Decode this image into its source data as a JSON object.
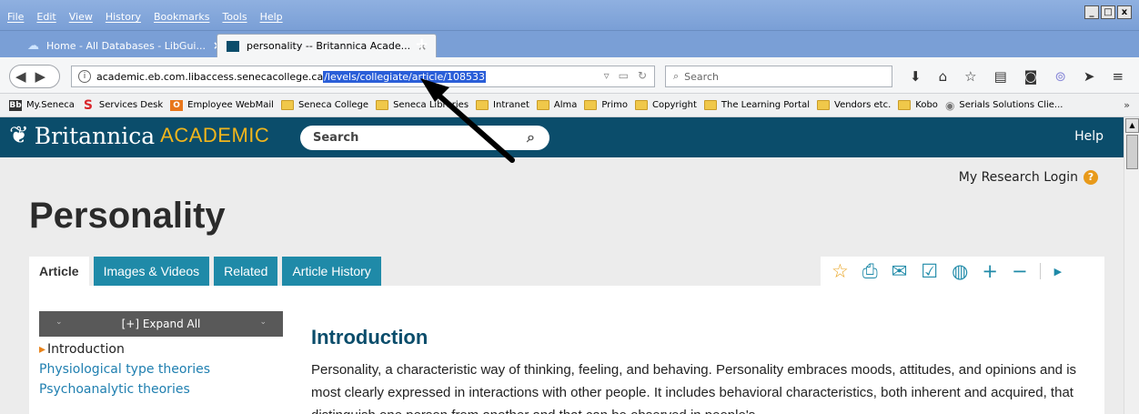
{
  "menu": [
    "File",
    "Edit",
    "View",
    "History",
    "Bookmarks",
    "Tools",
    "Help"
  ],
  "window_buttons": [
    "_",
    "□",
    "x"
  ],
  "tabs": [
    {
      "title": "Home - All Databases - LibGui...",
      "close": "×"
    },
    {
      "title": "personality -- Britannica Acade...",
      "close": "×"
    }
  ],
  "new_tab": "+",
  "url": {
    "host": "academic.eb.com.libaccess.senecacollege.ca",
    "path": "/levels/collegiate/article/108533"
  },
  "browser_search": {
    "placeholder": "Search"
  },
  "bookmarks": [
    {
      "label": "My.Seneca",
      "icon": "Bb"
    },
    {
      "label": "Services Desk",
      "icon": "S"
    },
    {
      "label": "Employee WebMail",
      "icon": "O"
    },
    {
      "label": "Seneca College",
      "icon": "folder"
    },
    {
      "label": "Seneca Libraries",
      "icon": "folder"
    },
    {
      "label": "Intranet",
      "icon": "folder"
    },
    {
      "label": "Alma",
      "icon": "folder"
    },
    {
      "label": "Primo",
      "icon": "folder"
    },
    {
      "label": "Copyright",
      "icon": "folder"
    },
    {
      "label": "The Learning Portal",
      "icon": "folder"
    },
    {
      "label": "Vendors etc.",
      "icon": "folder"
    },
    {
      "label": "Kobo",
      "icon": "folder"
    },
    {
      "label": "Serials Solutions Clie...",
      "icon": "globe"
    }
  ],
  "bookmarks_more": "»",
  "site": {
    "brand": "Britannica",
    "brand_sub": "ACADEMIC",
    "search_placeholder": "Search",
    "help": "Help",
    "login": "My Research Login",
    "login_icon": "?"
  },
  "article": {
    "title": "Personality",
    "tabs": [
      "Article",
      "Images & Videos",
      "Related",
      "Article History"
    ],
    "expand_all": "[+] Expand All",
    "toc": [
      "Introduction",
      "Physiological type theories",
      "Psychoanalytic theories"
    ],
    "heading": "Introduction",
    "text": "Personality,  a characteristic way of thinking, feeling, and behaving. Personality embraces moods, attitudes, and opinions and is most clearly expressed in interactions with other people. It includes behavioral characteristics, both inherent and acquired, that distinguish one person from another and that can be observed in people's"
  },
  "colors": {
    "header": "#0b4d6b",
    "tab": "#1f8aa8",
    "accent": "#f1b51c",
    "url_highlight": "#2a5ed8"
  }
}
